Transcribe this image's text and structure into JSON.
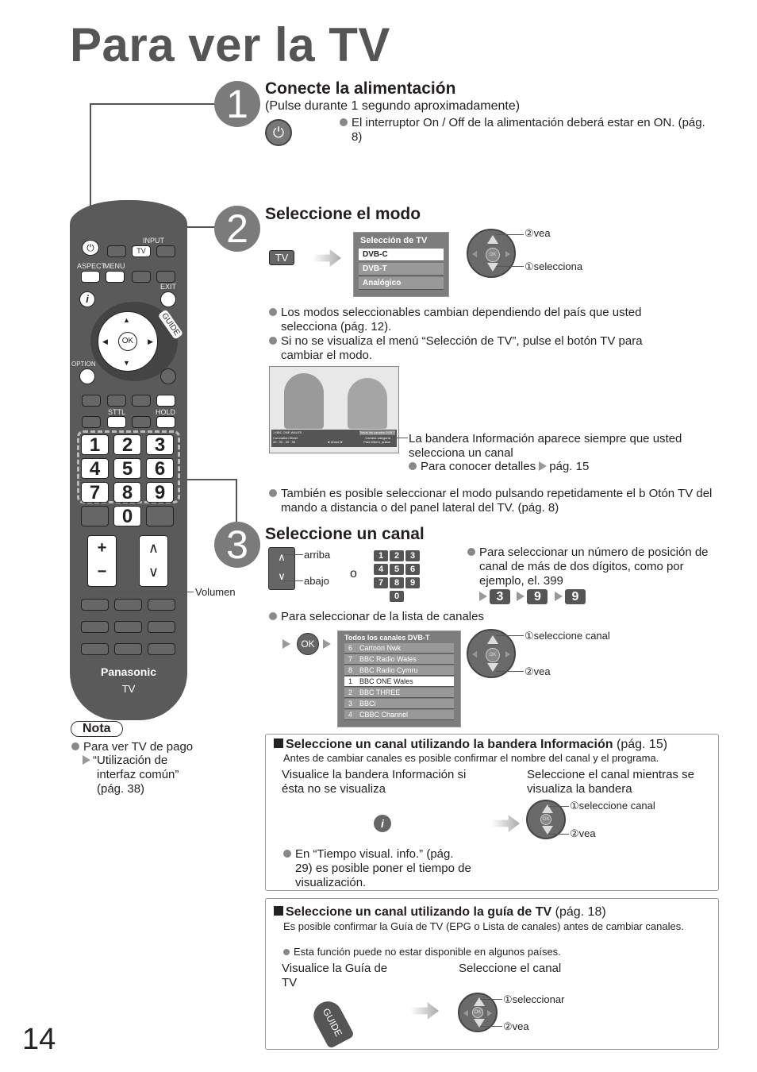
{
  "page": {
    "title": "Para ver la TV",
    "page_number": "14"
  },
  "step1": {
    "number": "1",
    "heading": "Conecte la alimentación",
    "subheading": "(Pulse durante 1 segundo aproximadamente)",
    "note": "El interruptor On / Off de la alimentación deberá estar en ON. (pág. 8)"
  },
  "step2": {
    "number": "2",
    "heading": "Seleccione el modo",
    "tv_button": "TV",
    "menu_title": "Selección de TV",
    "menu_items": [
      "DVB-C",
      "DVB-T",
      "Analógico"
    ],
    "dpad_view": "②vea",
    "dpad_select": "①selecciona",
    "bullet1": "Los modos seleccionables cambian dependiendo del país que usted selecciona (pág. 12).",
    "bullet2": "Si no se visualiza el menú “Selección de TV”, pulse el botón TV para cambiar el modo.",
    "banner_channel": "1 BBC ONE WALES",
    "banner_time": "20:35",
    "banner_tag": "Todos los canales DVB-T",
    "banner_program": "Coronation Street",
    "banner_prog_time": "20 : 00 - 20 : 55",
    "banner_mid": "◄ Ahora ►",
    "banner_change": "Cambio categoría",
    "banner_info": "Para inform. pulsar",
    "banner_caption": "La bandera Información aparece siempre que usted selecciona un canal",
    "banner_details": "Para conocer detalles",
    "banner_details_ref": "pág. 15",
    "bullet3": "También es posible seleccionar el modo pulsando repetidamente el b Otón TV del mando a distancia o del panel lateral del TV. (pág. 8)"
  },
  "step3": {
    "number": "3",
    "heading": "Seleccione un canal",
    "up_label": "arriba",
    "down_label": "abajo",
    "or_label": "o",
    "digits": [
      "1",
      "2",
      "3",
      "4",
      "5",
      "6",
      "7",
      "8",
      "9",
      "0"
    ],
    "multi_digit_note": "Para seleccionar un número de posición de canal de más de dos dígitos, como por ejemplo, el. 399",
    "example_digits": [
      "3",
      "9",
      "9"
    ],
    "list_note": "Para seleccionar de la lista de canales",
    "ok_label": "OK",
    "list_title": "Todos los canales DVB-T",
    "channels": [
      {
        "num": "6",
        "name": "Cartoon Nwk",
        "selected": false
      },
      {
        "num": "7",
        "name": "BBC Radio Wales",
        "selected": false
      },
      {
        "num": "8",
        "name": "BBC Radio Cymru",
        "selected": false
      },
      {
        "num": "1",
        "name": "BBC ONE Wales",
        "selected": true
      },
      {
        "num": "2",
        "name": "BBC THREE",
        "selected": false
      },
      {
        "num": "3",
        "name": "BBCi",
        "selected": false
      },
      {
        "num": "4",
        "name": "CBBC Channel",
        "selected": false
      }
    ],
    "dpad_select": "①seleccione canal",
    "dpad_view": "②vea"
  },
  "remote": {
    "labels": {
      "input": "INPUT",
      "tv": "TV",
      "aspect": "ASPECT",
      "menu": "MENU",
      "exit": "EXIT",
      "guide": "GUIDE",
      "ok": "OK",
      "option": "OPTION",
      "sttl": "STTL",
      "hold": "HOLD",
      "brand": "Panasonic",
      "model": "TV"
    },
    "keys": [
      "1",
      "2",
      "3",
      "4",
      "5",
      "6",
      "7",
      "8",
      "9",
      "0"
    ],
    "volume_label": "Volumen"
  },
  "nota": {
    "title": "Nota",
    "item": "Para ver TV de pago",
    "link": "“Utilización de interfaz común” (pág. 38)"
  },
  "box1": {
    "heading": "Seleccione un canal utilizando la bandera Información",
    "ref": "(pág. 15)",
    "desc": "Antes de cambiar canales es posible confirmar el nombre del canal y el programa.",
    "left_label": "Visualice la bandera Información si ésta no se visualiza",
    "right_label": "Seleccione el canal mientras se visualiza la bandera",
    "dpad_select": "①seleccione canal",
    "dpad_view": "②vea",
    "note": "En “Tiempo visual. info.” (pág. 29) es posible poner el tiempo de visualización."
  },
  "box2": {
    "heading": "Seleccione un canal utilizando la guía de TV",
    "ref": "(pág. 18)",
    "desc": "Es posible confirmar la Guía de TV (EPG o Lista de canales) antes de cambiar canales.",
    "note": "Esta función puede no estar disponible en algunos países.",
    "left_label": "Visualice la Guía de TV",
    "right_label": "Seleccione el canal",
    "guide_button": "GUIDE",
    "dpad_select": "①seleccionar",
    "dpad_view": "②vea"
  }
}
